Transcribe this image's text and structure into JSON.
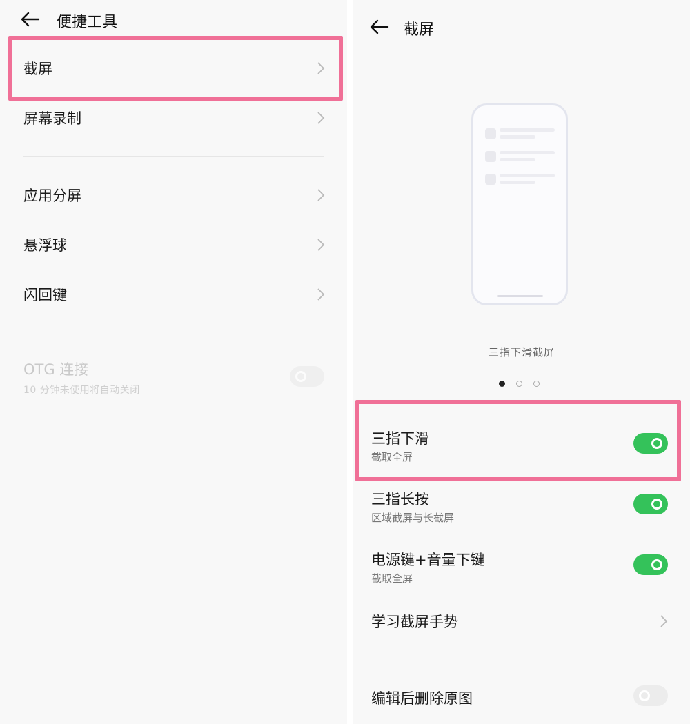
{
  "left_panel": {
    "header": {
      "back_icon": "arrow-left-icon",
      "title": "便捷工具"
    },
    "items": [
      {
        "label": "截屏"
      },
      {
        "label": "屏幕录制"
      },
      {
        "label": "应用分屏"
      },
      {
        "label": "悬浮球"
      },
      {
        "label": "闪回键"
      }
    ],
    "otg": {
      "title": "OTG 连接",
      "subtitle": "10 分钟未使用将自动关闭",
      "enabled": false,
      "state": "disabled"
    }
  },
  "right_panel": {
    "header": {
      "back_icon": "arrow-left-icon",
      "title": "截屏"
    },
    "illustration": {
      "caption": "三指下滑截屏",
      "carousel_pages": 3,
      "active_page": 1
    },
    "settings": [
      {
        "name": "三指下滑",
        "desc": "截取全屏",
        "enabled": true
      },
      {
        "name": "三指长按",
        "desc": "区域截屏与长截屏",
        "enabled": true
      },
      {
        "name": "电源键+音量下键",
        "desc": "截取全屏",
        "enabled": true
      }
    ],
    "learn": {
      "label": "学习截屏手势"
    },
    "delete_original": {
      "label": "编辑后删除原图",
      "enabled": false
    }
  },
  "colors": {
    "highlight": "#f07097",
    "toggle_on": "#34c25a",
    "toggle_off": "#ececec",
    "background": "#f8f8f8"
  }
}
